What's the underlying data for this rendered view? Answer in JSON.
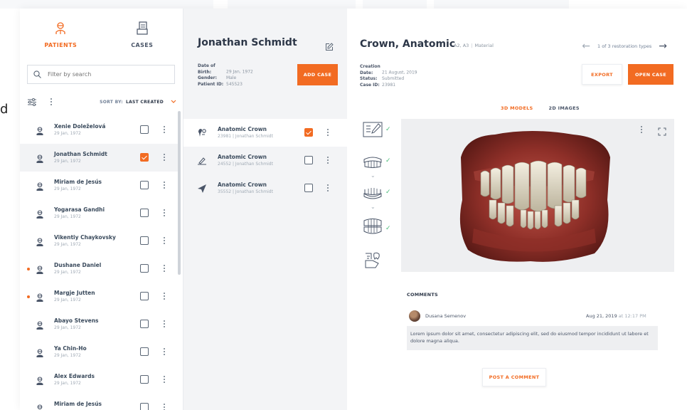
{
  "colors": {
    "accent": "#f26b22",
    "check": "#48bb78"
  },
  "background": {
    "left_letter": "d"
  },
  "tabs": [
    {
      "label": "PATIENTS",
      "icon": "patient-icon",
      "active": true
    },
    {
      "label": "CASES",
      "icon": "cases-icon",
      "active": false
    }
  ],
  "search": {
    "placeholder": "Filter by search"
  },
  "sort": {
    "prefix": "SORT BY:",
    "value": "LAST CREATED"
  },
  "patients": [
    {
      "name": "Xenie Doleželová",
      "date": "29 Jan, 1972",
      "checked": false,
      "selected": false,
      "flag": false
    },
    {
      "name": "Jonathan Schmidt",
      "date": "29 Jan, 1972",
      "checked": true,
      "selected": true,
      "flag": false
    },
    {
      "name": "Miriam de Jesús",
      "date": "29 Jan, 1972",
      "checked": false,
      "selected": false,
      "flag": false
    },
    {
      "name": "Yogarasa Gandhi",
      "date": "29 Jan, 1972",
      "checked": false,
      "selected": false,
      "flag": false
    },
    {
      "name": "Vikentiy Chaykovsky",
      "date": "29 Jan, 1972",
      "checked": false,
      "selected": false,
      "flag": false
    },
    {
      "name": "Dushane Daniel",
      "date": "29 Jan, 1972",
      "checked": false,
      "selected": false,
      "flag": true
    },
    {
      "name": "Margje Jutten",
      "date": "29 Jan, 1972",
      "checked": false,
      "selected": false,
      "flag": true
    },
    {
      "name": "Abayo Stevens",
      "date": "29 Jan, 1972",
      "checked": false,
      "selected": false,
      "flag": false
    },
    {
      "name": "Ya Chin-Ho",
      "date": "29 Jan, 1972",
      "checked": false,
      "selected": false,
      "flag": false
    },
    {
      "name": "Alex Edwards",
      "date": "29 Jan, 1972",
      "checked": false,
      "selected": false,
      "flag": false
    },
    {
      "name": "Miriam de Jesús",
      "date": "",
      "checked": false,
      "selected": false,
      "flag": false
    }
  ],
  "patient_detail": {
    "name": "Jonathan Schmidt",
    "fields": [
      {
        "key": "Date of Birth:",
        "value": "29 Jan, 1972"
      },
      {
        "key": "Gender:",
        "value": "Male"
      },
      {
        "key": "Patient ID:",
        "value": "545523"
      }
    ],
    "add_case_label": "ADD CASE"
  },
  "cases": [
    {
      "title": "Anatomic Crown",
      "sub": "23981 | Jonathan Schmidt",
      "icon": "tooth-scan-icon",
      "checked": true,
      "selected": true
    },
    {
      "title": "Anatomic Crown",
      "sub": "24552 | Jonathan Schmidt",
      "icon": "pen-tool-icon",
      "checked": false,
      "selected": false
    },
    {
      "title": "Anatomic Crown",
      "sub": "35552 | Jonathan Schmidt",
      "icon": "send-icon",
      "checked": false,
      "selected": false
    }
  ],
  "case_detail": {
    "title": "Crown, Anatomic",
    "shade": "A2, A3",
    "material": "Material",
    "pager_text": "1 of 3 restoration types",
    "fields": [
      {
        "key": "Creation Date:",
        "value": "21 August, 2019"
      },
      {
        "key": "Status:",
        "value": "Submitted"
      },
      {
        "key": "Case ID:",
        "value": "23981"
      }
    ],
    "export_label": "EXPORT",
    "open_case_label": "OPEN CASE",
    "view_tabs": [
      {
        "label": "3D MODELS",
        "active": true
      },
      {
        "label": "2D IMAGES",
        "active": false
      }
    ]
  },
  "workflow_steps": [
    {
      "icon": "prescription-form-icon",
      "done": true
    },
    {
      "icon": "upper-jaw-icon",
      "done": true
    },
    {
      "icon": "lower-jaw-icon",
      "done": true
    },
    {
      "icon": "bite-scan-icon",
      "done": true
    },
    {
      "icon": "hand-tooth-icon",
      "done": false
    }
  ],
  "comments": {
    "title": "COMMENTS",
    "author": "Dusana Semenov",
    "date": "Aug 21, 2019",
    "time": "at 12:17 PM",
    "text": "Lorem ipsum dolor sit amet, consectetur adipiscing elit, sed do eiusmod tempor incididunt ut labore et dolore magna aliqua.",
    "post_label": "POST A COMMENT"
  }
}
